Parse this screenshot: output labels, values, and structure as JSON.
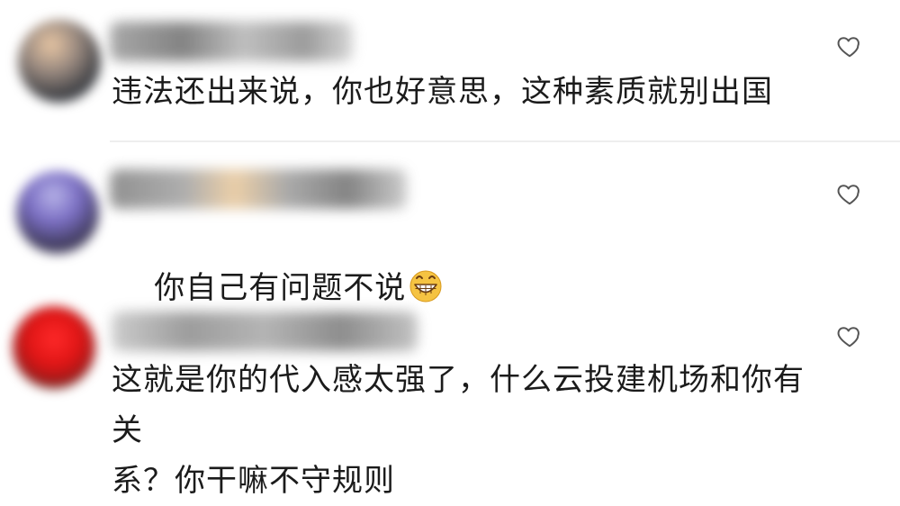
{
  "comments": [
    {
      "text": "违法还出来说，你也好意思，这种素质就别出国",
      "like_icon": "heart-outline-icon"
    },
    {
      "text": "你自己有问题不说",
      "emoji_icon": "grinning-face-emoji-icon",
      "like_icon": "heart-outline-icon"
    },
    {
      "text": "这就是你的代入感太强了，什么云投建机场和你有关\n系？你干嘛不守规则",
      "like_icon": "heart-outline-icon"
    }
  ],
  "colors": {
    "text": "#1b1b1b",
    "divider": "#eeeeee",
    "icon": "#555555",
    "emoji_face": "#f5c342"
  }
}
